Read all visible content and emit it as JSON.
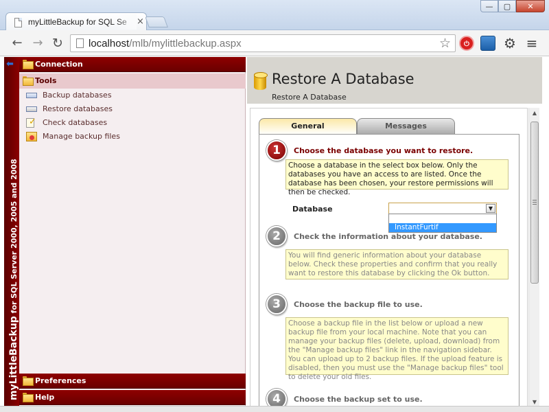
{
  "browser": {
    "tab_title": "myLittleBackup for SQL Se",
    "tab_close": "×",
    "url_host": "localhost",
    "url_path": "/mlb/mylittlebackup.aspx",
    "window_buttons": {
      "minimize": "—",
      "maximize": "▢",
      "close": "✕"
    },
    "nav": {
      "back": "←",
      "forward": "→",
      "reload": "↻"
    },
    "star": "☆",
    "ext_stop": "⏻",
    "gear": "⚙",
    "menu": "≡"
  },
  "banner": {
    "brand": "myLittleBackup",
    "tagline": " for SQL Server 2000, 2005 and 2008",
    "back_arrow": "⬅"
  },
  "sidebar": {
    "connection": "Connection",
    "tools": "Tools",
    "items": [
      {
        "label": "Backup databases",
        "icon": "backup-icon"
      },
      {
        "label": "Restore databases",
        "icon": "restore-icon"
      },
      {
        "label": "Check databases",
        "icon": "check-icon"
      },
      {
        "label": "Manage backup files",
        "icon": "manage-files-icon"
      }
    ],
    "preferences": "Preferences",
    "help": "Help"
  },
  "main": {
    "title": "Restore A Database",
    "breadcrumb": "Restore A Database",
    "tabs": [
      {
        "label": "General",
        "active": true
      },
      {
        "label": "Messages",
        "active": false
      }
    ]
  },
  "steps": [
    {
      "number": "1",
      "title": "Choose the database you want to restore.",
      "text": "Choose a database in the select box below. Only the databases you have an access to are listed. Once the database has been chosen, your restore permissions will then be checked.",
      "active": true
    },
    {
      "number": "2",
      "title": "Check the information about your database.",
      "text": "You will find generic information about your database below. Check these properties and confirm that you really want to restore this database by clicking the Ok button.",
      "active": false
    },
    {
      "number": "3",
      "title": "Choose the backup file to use.",
      "text": "Choose a backup file in the list below or upload a new backup file from your local machine. Note that you can manage your backup files (delete, upload, download) from the \"Manage backup files\" link in the navigation sidebar. You can upload up to 2 backup files. If the upload feature is disabled, then you must use the \"Manage backup files\" tool to delete your old files.",
      "active": false
    },
    {
      "number": "4",
      "title": "Choose the backup set to use.",
      "active": false
    }
  ],
  "database": {
    "label": "Database",
    "selected": "",
    "options": [
      "",
      "InstantFurtif"
    ],
    "arrow": "▼"
  },
  "scrollbar": {
    "up": "▲",
    "down": "▼"
  },
  "colors": {
    "sidebar_header": "#7a0000",
    "accent": "#3399ff",
    "infobox": "#fffdcc"
  }
}
